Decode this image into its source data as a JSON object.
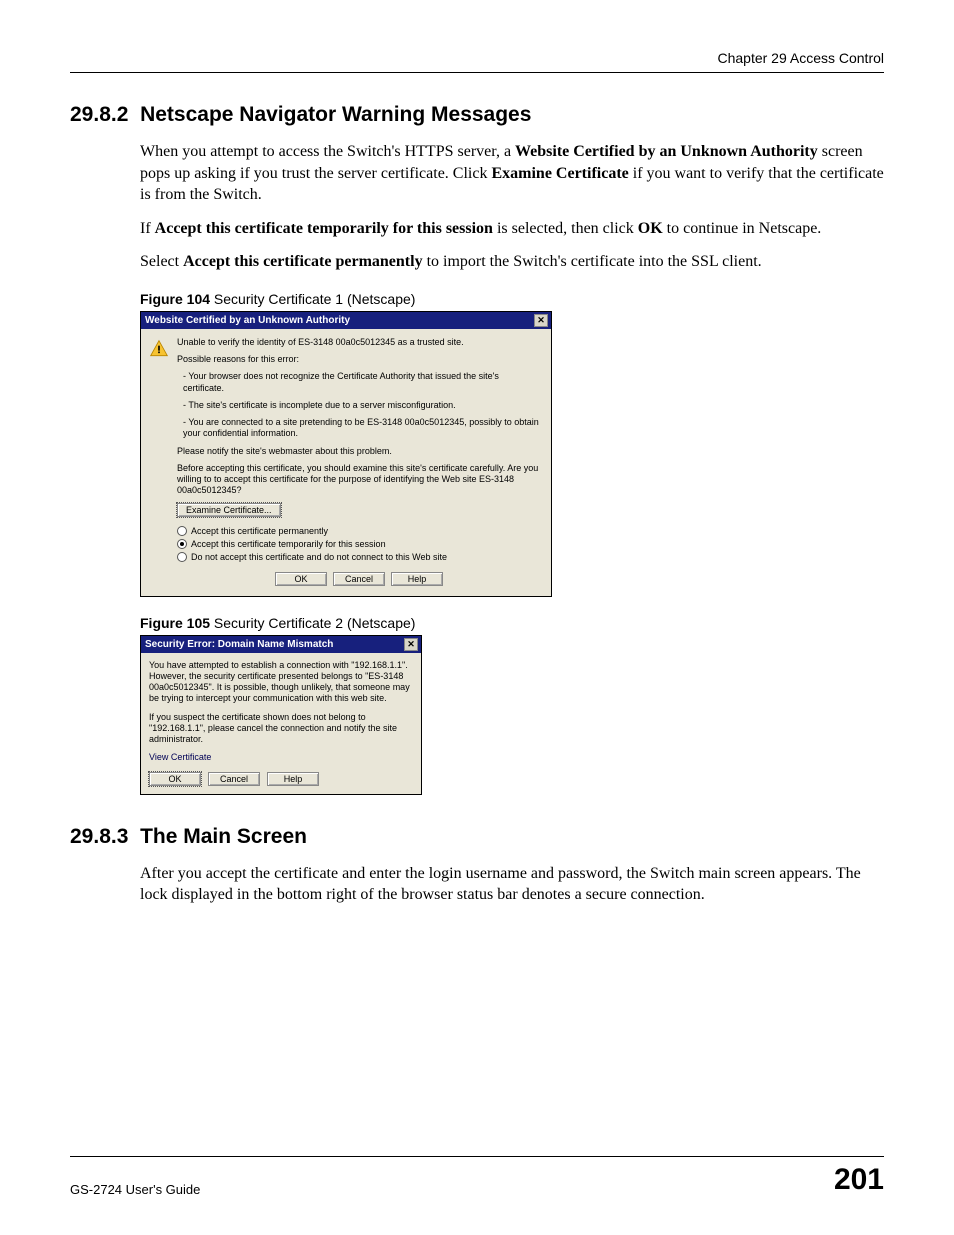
{
  "header": {
    "chapter": "Chapter 29 Access Control"
  },
  "section1": {
    "number": "29.8.2",
    "title": "Netscape Navigator Warning Messages",
    "p1_a": "When you attempt to access the Switch's HTTPS server, a ",
    "p1_b1": "Website Certified by an Unknown Authority",
    "p1_c": " screen pops up asking if you trust the server certificate. Click ",
    "p1_b2": "Examine Certificate",
    "p1_d": " if you want to verify that the certificate is from the Switch.",
    "p2_a": "If ",
    "p2_b1": "Accept this certificate temporarily for this session",
    "p2_c": " is selected, then click ",
    "p2_b2": "OK",
    "p2_d": " to continue in Netscape.",
    "p3_a": "Select ",
    "p3_b1": "Accept this certificate permanently",
    "p3_c": " to import the Switch's certificate into the SSL client."
  },
  "figure104": {
    "label_num": "Figure 104",
    "label_text": "   Security Certificate 1 (Netscape)",
    "dialog": {
      "title": "Website Certified by an Unknown Authority",
      "line1": "Unable to verify the identity of ES-3148 00a0c5012345 as a trusted site.",
      "line2": "Possible reasons for this error:",
      "bullet1": "- Your browser does not recognize the Certificate Authority that issued the site's certificate.",
      "bullet2": "- The site's certificate is incomplete due to a server misconfiguration.",
      "bullet3": "- You are connected to a site pretending to be ES-3148 00a0c5012345, possibly to obtain your confidential information.",
      "notify": "Please notify the site's webmaster about this problem.",
      "warn": "Before accepting this certificate, you should examine this site's certificate carefully. Are you willing to to accept this certificate for the purpose of identifying the Web site ES-3148 00a0c5012345?",
      "examine_btn": "Examine Certificate...",
      "radio_perm": "Accept this certificate permanently",
      "radio_temp": "Accept this certificate temporarily for this session",
      "radio_reject": "Do not accept this certificate and do not connect to this Web site",
      "ok": "OK",
      "cancel": "Cancel",
      "help": "Help"
    }
  },
  "figure105": {
    "label_num": "Figure 105",
    "label_text": "   Security Certificate 2 (Netscape)",
    "dialog": {
      "title": "Security Error: Domain Name Mismatch",
      "p1": "You have attempted to establish a connection with \"192.168.1.1\". However, the security certificate presented belongs to \"ES-3148 00a0c5012345\". It is possible, though unlikely, that someone may be trying to intercept your communication with this web site.",
      "p2": "If you suspect the certificate shown does not belong to \"192.168.1.1\", please cancel the connection and notify the site administrator.",
      "view_cert": "View Certificate",
      "ok": "OK",
      "cancel": "Cancel",
      "help": "Help"
    }
  },
  "section2": {
    "number": "29.8.3",
    "title": "The Main Screen",
    "p1": "After you accept the certificate and enter the login username and password, the Switch main screen appears. The lock displayed in the bottom right of the browser status bar denotes a secure connection."
  },
  "footer": {
    "guide": "GS-2724 User's Guide",
    "page": "201"
  },
  "colors": {
    "titlebar": "#17207d",
    "dialog_bg": "#e9e6d8"
  }
}
